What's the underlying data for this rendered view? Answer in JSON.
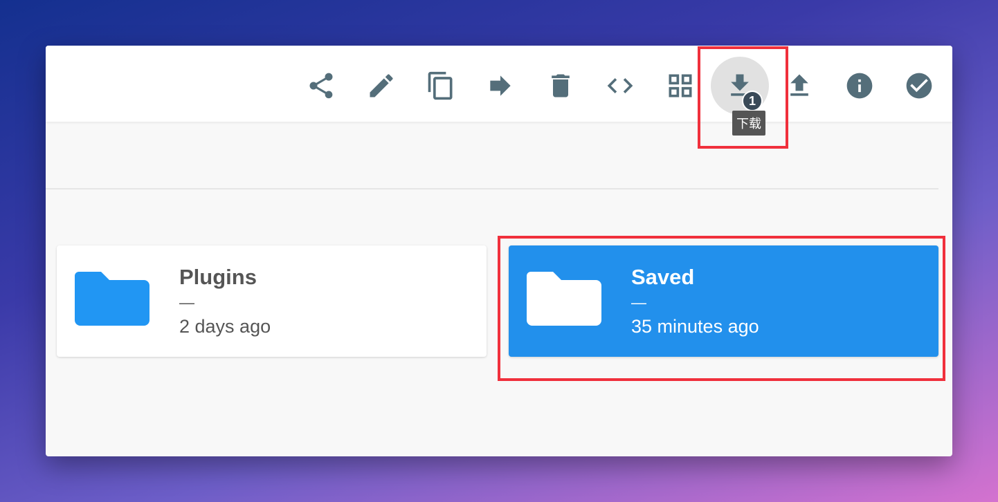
{
  "toolbar": {
    "actions": [
      {
        "name": "share",
        "icon": "share-icon"
      },
      {
        "name": "rename",
        "icon": "pencil-icon"
      },
      {
        "name": "copy",
        "icon": "copy-icon"
      },
      {
        "name": "move",
        "icon": "arrow-forward-icon"
      },
      {
        "name": "delete",
        "icon": "trash-icon"
      },
      {
        "name": "embed",
        "icon": "code-icon"
      },
      {
        "name": "switch-view",
        "icon": "grid-icon"
      },
      {
        "name": "download",
        "icon": "download-icon",
        "badge": "1",
        "tooltip": "下载"
      },
      {
        "name": "upload",
        "icon": "upload-icon"
      },
      {
        "name": "info",
        "icon": "info-icon"
      },
      {
        "name": "select-all",
        "icon": "check-circle-icon"
      }
    ],
    "download_badge": "1",
    "download_tooltip": "下载"
  },
  "listing": {
    "items": [
      {
        "name": "Plugins",
        "size": "—",
        "modified": "2 days ago",
        "selected": false
      },
      {
        "name": "Saved",
        "size": "—",
        "modified": "35 minutes ago",
        "selected": true
      }
    ]
  },
  "colors": {
    "accent": "#2196f3",
    "selected_bg": "#2290ec",
    "icon": "#546e7a",
    "highlight": "#f0303c"
  }
}
